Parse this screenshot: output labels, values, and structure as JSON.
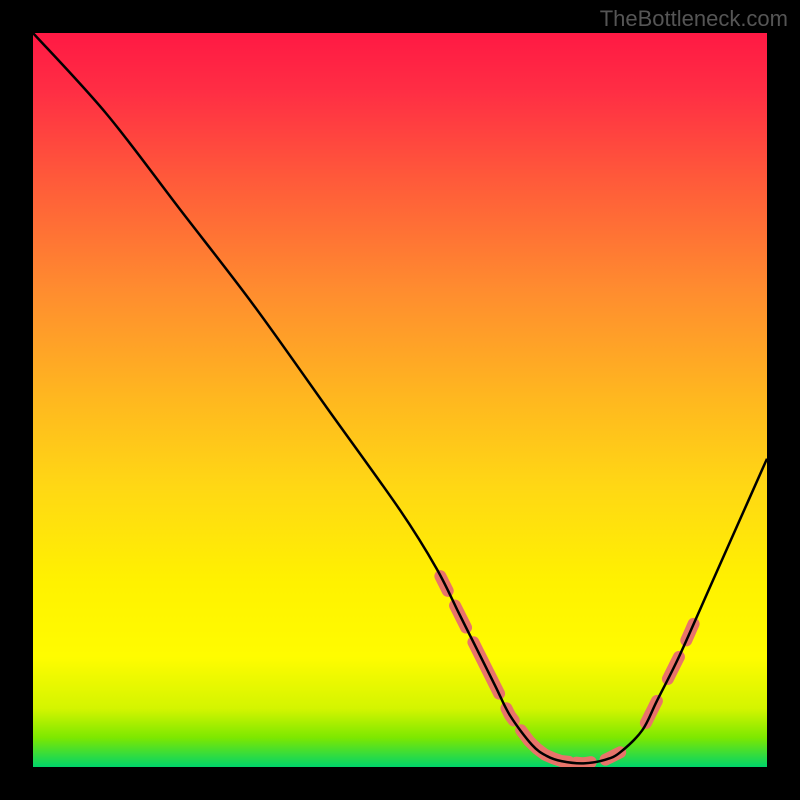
{
  "watermark": "TheBottleneck.com",
  "chart_data": {
    "type": "line",
    "title": "",
    "xlabel": "",
    "ylabel": "",
    "xlim": [
      0,
      100
    ],
    "ylim": [
      0,
      100
    ],
    "curve_points": [
      {
        "x": 0,
        "y": 100
      },
      {
        "x": 10,
        "y": 89
      },
      {
        "x": 20,
        "y": 76
      },
      {
        "x": 30,
        "y": 63
      },
      {
        "x": 40,
        "y": 49
      },
      {
        "x": 50,
        "y": 35
      },
      {
        "x": 55,
        "y": 27
      },
      {
        "x": 58,
        "y": 21
      },
      {
        "x": 60,
        "y": 17
      },
      {
        "x": 63,
        "y": 11
      },
      {
        "x": 65,
        "y": 7
      },
      {
        "x": 68,
        "y": 3
      },
      {
        "x": 70,
        "y": 1.5
      },
      {
        "x": 72,
        "y": 0.8
      },
      {
        "x": 75,
        "y": 0.5
      },
      {
        "x": 78,
        "y": 1
      },
      {
        "x": 80,
        "y": 2
      },
      {
        "x": 83,
        "y": 5
      },
      {
        "x": 85,
        "y": 9
      },
      {
        "x": 88,
        "y": 15
      },
      {
        "x": 92,
        "y": 24
      },
      {
        "x": 96,
        "y": 33
      },
      {
        "x": 100,
        "y": 42
      }
    ],
    "highlight_segments": [
      {
        "x_start": 55.5,
        "x_end": 56.5
      },
      {
        "x_start": 57.5,
        "x_end": 59
      },
      {
        "x_start": 60,
        "x_end": 63.5
      },
      {
        "x_start": 64.5,
        "x_end": 65.5
      },
      {
        "x_start": 66.5,
        "x_end": 73
      },
      {
        "x_start": 74,
        "x_end": 76
      },
      {
        "x_start": 78,
        "x_end": 80
      },
      {
        "x_start": 83.5,
        "x_end": 85
      },
      {
        "x_start": 86.5,
        "x_end": 88
      },
      {
        "x_start": 89,
        "x_end": 90
      }
    ],
    "gradient_colors": {
      "top": "#ff1944",
      "middle": "#ffe000",
      "bottom": "#00d46a"
    },
    "highlight_color": "#e8746a"
  }
}
